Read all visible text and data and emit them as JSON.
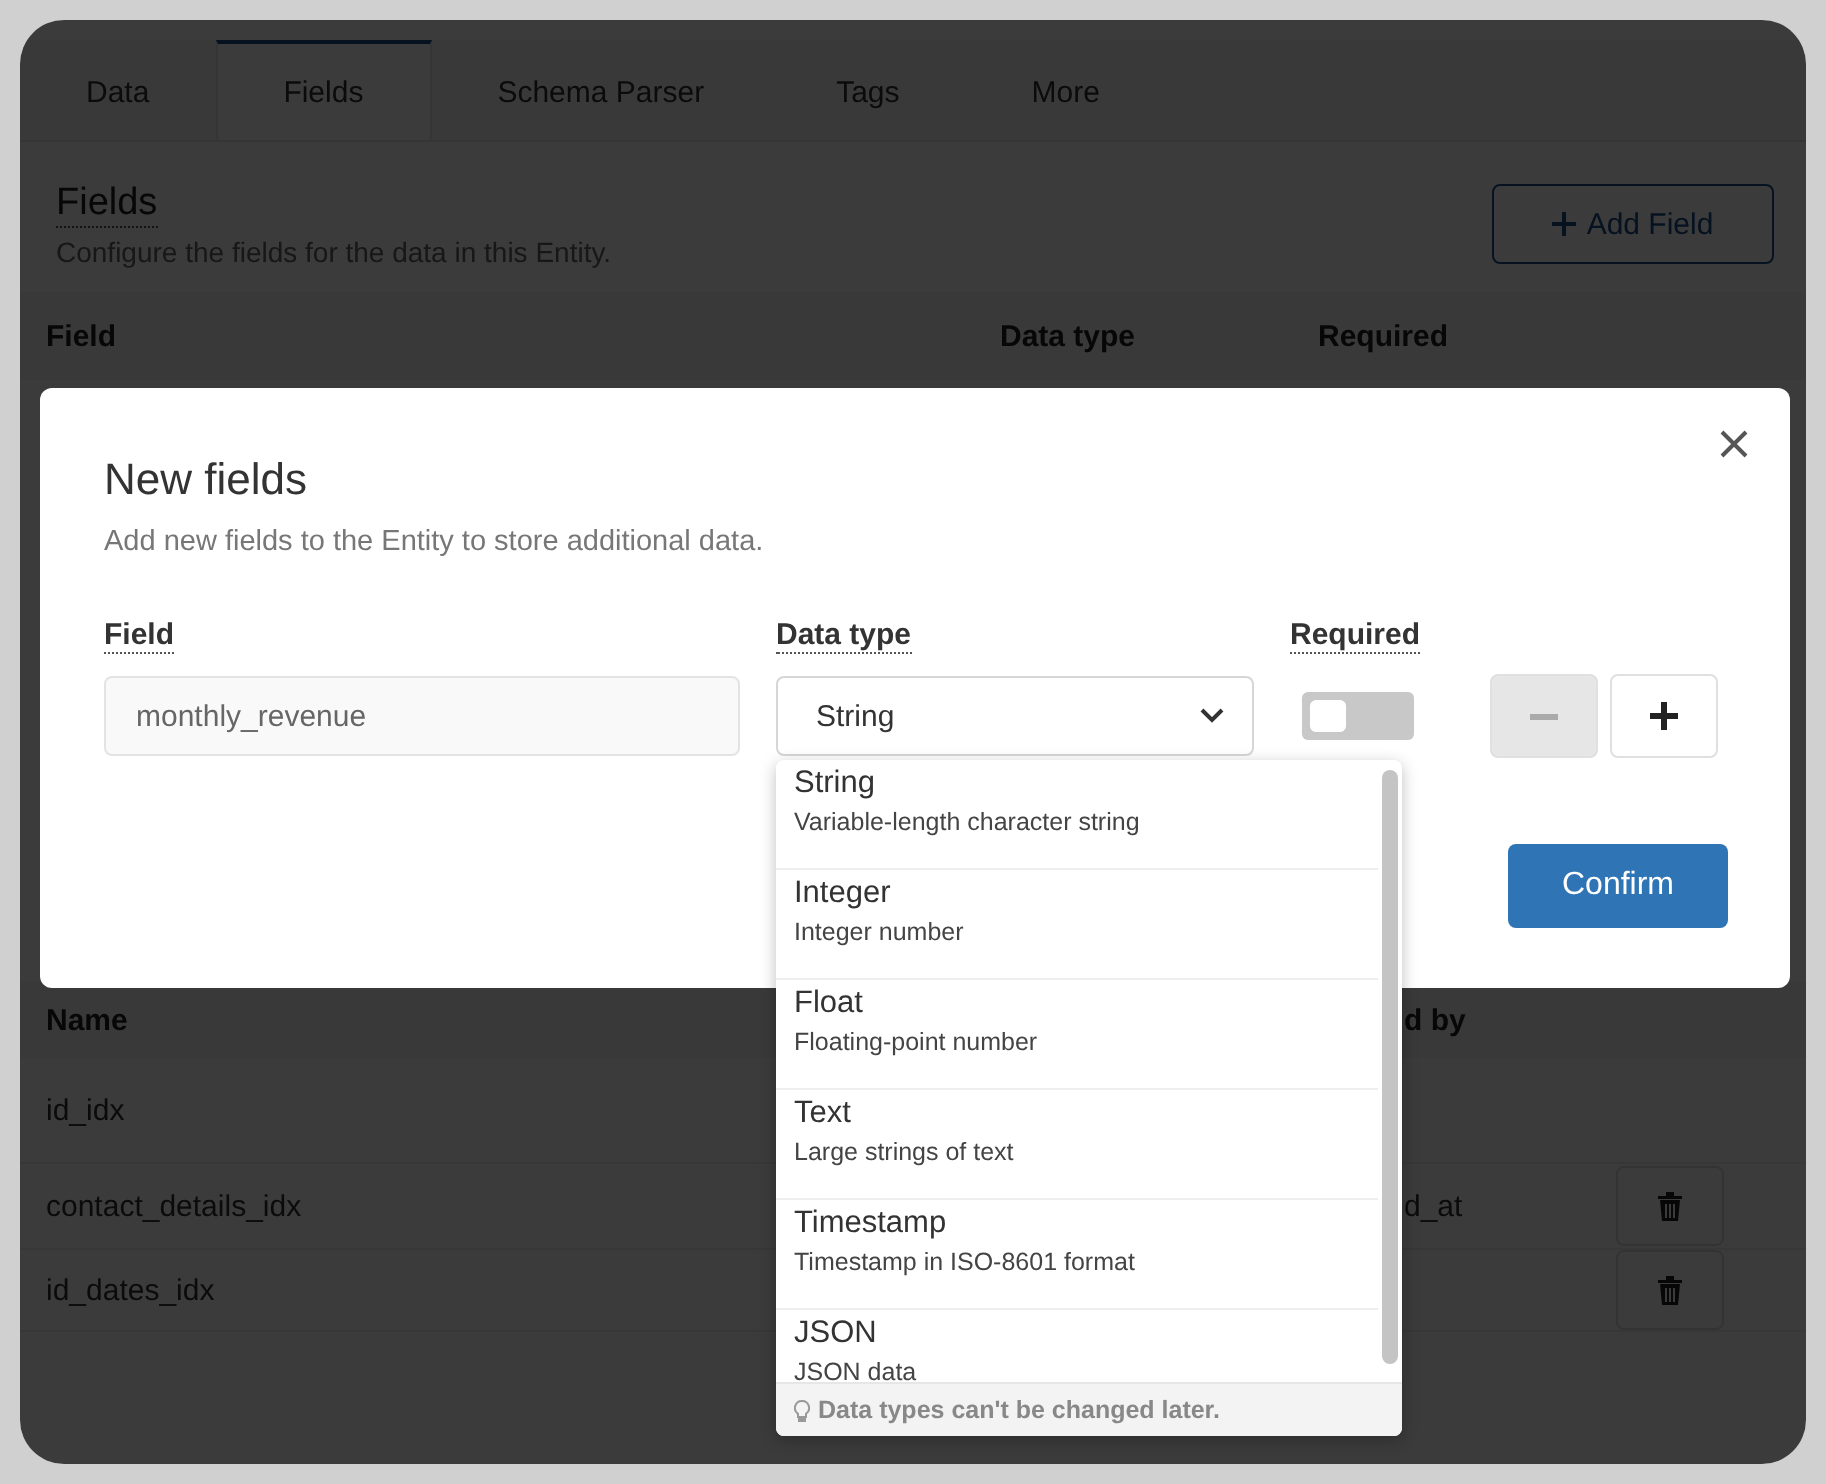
{
  "tabs": [
    {
      "label": "Data",
      "selected": false
    },
    {
      "label": "Fields",
      "selected": true
    },
    {
      "label": "Schema Parser",
      "selected": false
    },
    {
      "label": "Tags",
      "selected": false
    },
    {
      "label": "More",
      "selected": false
    }
  ],
  "section": {
    "title": "Fields",
    "description": "Configure the fields for the data in this Entity.",
    "add_button": "Add Field"
  },
  "fields_table": {
    "columns": [
      "Field",
      "Data type",
      "Required"
    ]
  },
  "indexes_table": {
    "columns": [
      "Name",
      "d by"
    ],
    "rows": [
      {
        "name": "id_idx",
        "deletable": false
      },
      {
        "name": "contact_details_idx",
        "column_2": "d_at",
        "deletable": true
      },
      {
        "name": "id_dates_idx",
        "deletable": true
      }
    ]
  },
  "dialog": {
    "title": "New fields",
    "description": "Add new fields to the Entity to store additional data.",
    "columns": [
      "Field",
      "Data type",
      "Required"
    ],
    "row": {
      "field_value": "monthly_revenue",
      "data_type": "String",
      "required": false
    },
    "remove_disabled": true,
    "confirm": "Confirm"
  },
  "dropdown": {
    "options": [
      {
        "label": "String",
        "description": "Variable-length character string"
      },
      {
        "label": "Integer",
        "description": "Integer number"
      },
      {
        "label": "Float",
        "description": "Floating-point number"
      },
      {
        "label": "Text",
        "description": "Large strings of text"
      },
      {
        "label": "Timestamp",
        "description": "Timestamp in ISO-8601 format"
      },
      {
        "label": "JSON",
        "description": "JSON data"
      }
    ],
    "hint": "Data types can't be changed later."
  }
}
